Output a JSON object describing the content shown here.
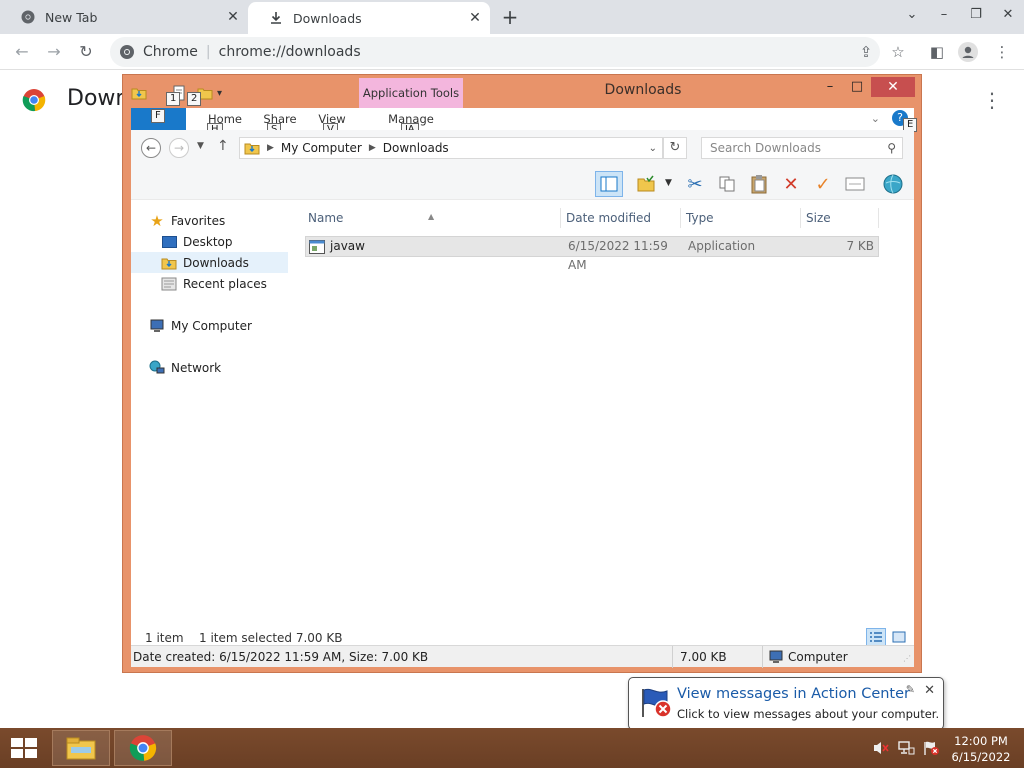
{
  "browser": {
    "tabs": [
      {
        "label": "New Tab",
        "close": "✕"
      },
      {
        "label": "Downloads",
        "close": "✕"
      }
    ],
    "new_tab": "+",
    "window_controls": {
      "chevron": "⌄",
      "minimize": "–",
      "restore": "❐",
      "close": "✕"
    },
    "omnibox": {
      "site_name": "Chrome",
      "separator": "|",
      "url": "chrome://downloads"
    },
    "page_title": "Down",
    "page_menu": "⋮"
  },
  "explorer": {
    "title": "Downloads",
    "contextual_tab_group": "Application Tools",
    "keytips": {
      "qat1": "1",
      "qat2": "2",
      "file": "F",
      "home": "H",
      "share": "S",
      "view": "V",
      "manage": "JA",
      "help": "E"
    },
    "ribbon_tabs": {
      "file": "",
      "home": "Home",
      "share": "Share",
      "view": "View",
      "manage": "Manage"
    },
    "window_buttons": {
      "minimize": "–",
      "maximize": "□",
      "close": "✕"
    },
    "address": {
      "crumbs": [
        "My Computer",
        "Downloads"
      ]
    },
    "search_placeholder": "Search Downloads",
    "nav": {
      "favorites": "Favorites",
      "desktop": "Desktop",
      "downloads": "Downloads",
      "recent": "Recent places",
      "computer": "My Computer",
      "network": "Network"
    },
    "columns": {
      "name": "Name",
      "date": "Date modified",
      "type": "Type",
      "size": "Size"
    },
    "files": [
      {
        "name": "javaw",
        "date": "6/15/2022 11:59 AM",
        "type": "Application",
        "size": "7 KB"
      }
    ],
    "status": {
      "count": "1 item",
      "selection": "1 item selected  7.00 KB"
    },
    "details_bar": {
      "created": "Date created: 6/15/2022 11:59 AM, Size: 7.00 KB",
      "size": "7.00 KB",
      "location": "Computer"
    }
  },
  "balloon": {
    "title": "View messages in Action Center",
    "text": "Click to view messages about your computer.",
    "close": "✕"
  },
  "taskbar": {
    "time": "12:00 PM",
    "date": "6/15/2022"
  },
  "colors": {
    "explorer_frame": "#e8936a",
    "file_tab": "#1979ca",
    "app_tools": "#f3b6dd",
    "taskbar": "#6a3f25"
  }
}
